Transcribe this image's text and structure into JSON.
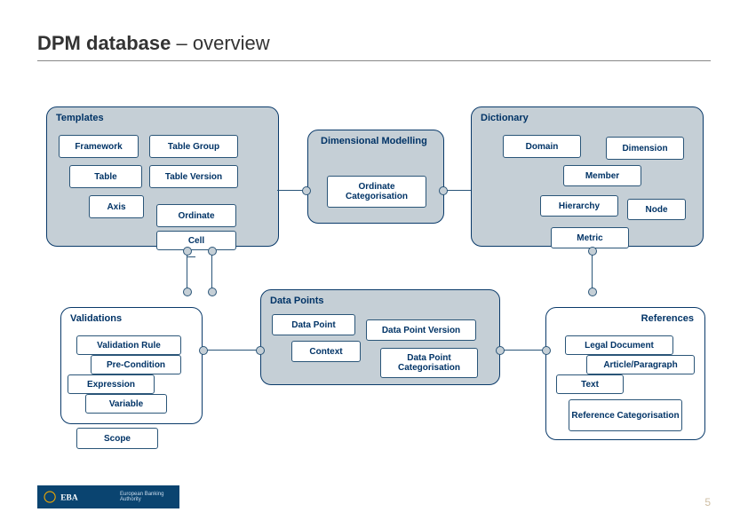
{
  "title_bold": "DPM database",
  "title_rest": " – overview",
  "page_number": "5",
  "logo_acronym": "EBA",
  "logo_subtext": "European Banking Authority",
  "panels": {
    "templates": "Templates",
    "dictionary": "Dictionary",
    "dimModel": "Dimensional Modelling",
    "dataPoints": "Data Points",
    "validations": "Validations",
    "references": "References"
  },
  "nodes": {
    "framework": "Framework",
    "tableGroup": "Table Group",
    "table": "Table",
    "tableVersion": "Table Version",
    "axis": "Axis",
    "ordinate": "Ordinate",
    "cell": "Cell",
    "ordinateCat": "Ordinate Categorisation",
    "domain": "Domain",
    "dimension": "Dimension",
    "member": "Member",
    "hierarchy": "Hierarchy",
    "node": "Node",
    "metric": "Metric",
    "dataPoint": "Data Point",
    "dataPointVersion": "Data Point Version",
    "context": "Context",
    "dataPointCat": "Data Point Categorisation",
    "validationRule": "Validation Rule",
    "preCondition": "Pre-Condition",
    "expression": "Expression",
    "variable": "Variable",
    "scope": "Scope",
    "legalDocument": "Legal Document",
    "articlePara": "Article/Paragraph",
    "text": "Text",
    "refCat": "Reference Categorisation"
  }
}
